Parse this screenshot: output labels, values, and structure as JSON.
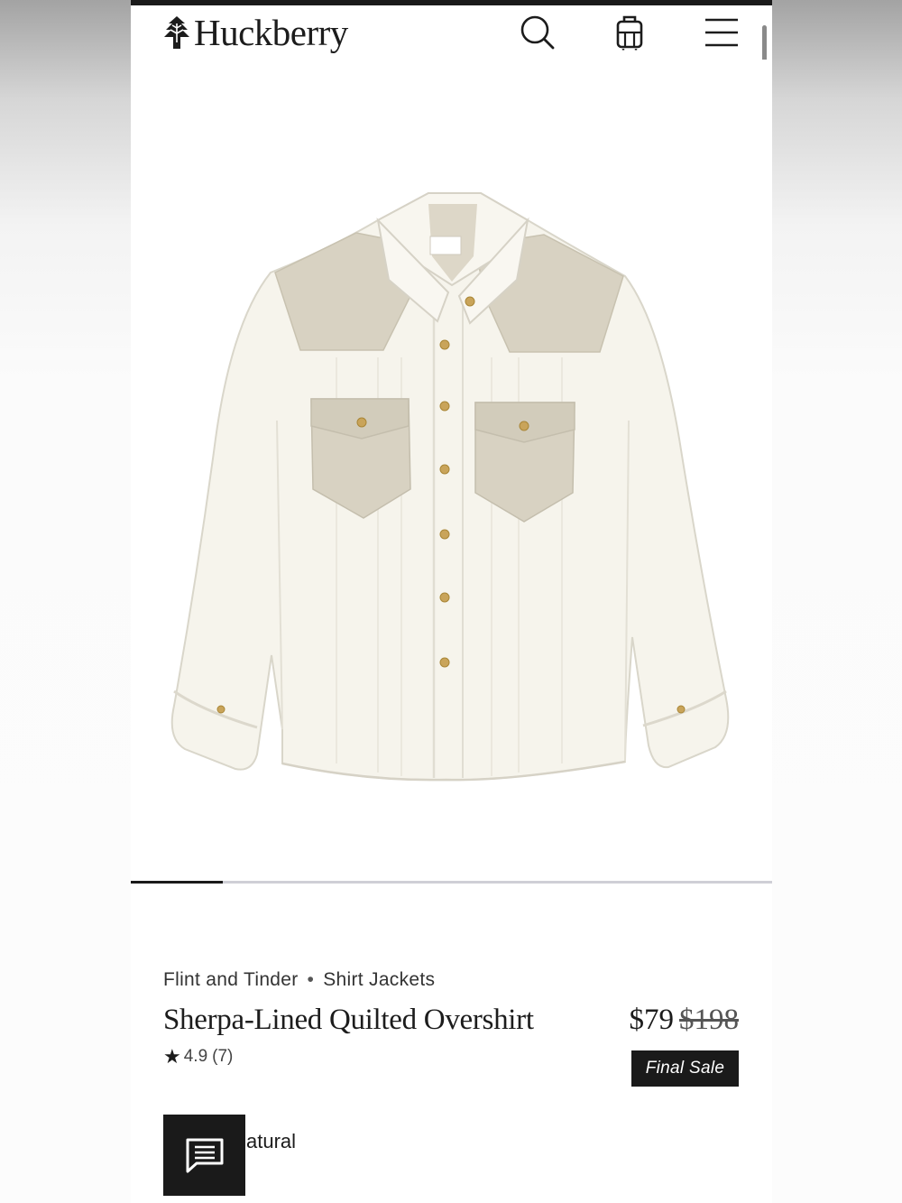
{
  "header": {
    "brand": "Huckberry",
    "icons": [
      "tree-logo-icon",
      "search-icon",
      "cart-icon",
      "menu-icon"
    ]
  },
  "product": {
    "image_alt": "Sherpa-Lined Quilted Overshirt in natural with khaki yoke and pockets",
    "brand": "Flint and Tinder",
    "separator": "•",
    "category": "Shirt Jackets",
    "title": "Sherpa-Lined Quilted Overshirt",
    "rating": "4.9",
    "review_count": "(7)",
    "price": "$79",
    "original_price": "$198",
    "badge": "Final Sale",
    "color_label_partial": "atural",
    "image_position": {
      "current": 1,
      "total": 7
    }
  },
  "chat": {
    "icon": "chat-icon"
  },
  "colors": {
    "accent": "#1a1a1a",
    "shirt": "#f6f4ec",
    "yoke": "#d8d2c2"
  }
}
